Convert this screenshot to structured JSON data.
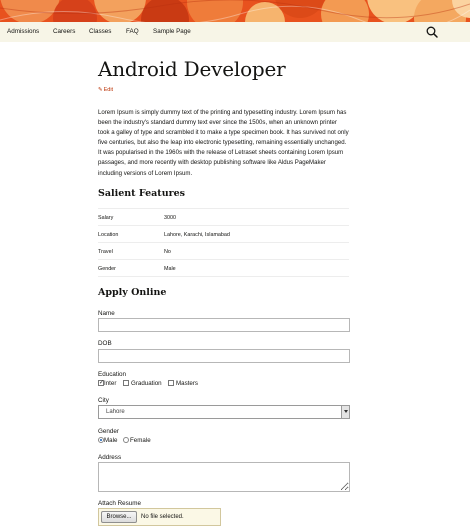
{
  "nav": {
    "items": [
      "Admissions",
      "Careers",
      "Classes",
      "FAQ",
      "Sample Page"
    ],
    "search_icon": "search-icon"
  },
  "colors": {
    "banner": "#e8521e",
    "nav_bg": "#f7f5e7",
    "link": "#bc360a"
  },
  "page": {
    "title": "Android Developer",
    "edit_label": "Edit",
    "description": "Lorem Ipsum is simply dummy text of the printing and typesetting industry. Lorem Ipsum has been the industry's standard dummy text ever since the 1500s, when an unknown printer took a galley of type and scrambled it to make a type specimen book. It has survived not only five centuries, but also the leap into electronic typesetting, remaining essentially unchanged. It was popularised in the 1960s with the release of Letraset sheets containing Lorem Ipsum passages, and more recently with desktop publishing software like Aldus PageMaker including versions of Lorem Ipsum."
  },
  "features": {
    "heading": "Salient Features",
    "rows": [
      {
        "label": "Salary",
        "value": "3000"
      },
      {
        "label": "Location",
        "value": "Lahore, Karachi, Islamabad"
      },
      {
        "label": "Travel",
        "value": "No"
      },
      {
        "label": "Gender",
        "value": "Male"
      }
    ]
  },
  "form": {
    "heading": "Apply Online",
    "name_label": "Name",
    "name_value": "",
    "dob_label": "DOB",
    "dob_value": "",
    "education_label": "Education",
    "education_options": [
      {
        "label": "Inter",
        "checked": true
      },
      {
        "label": "Graduation",
        "checked": false
      },
      {
        "label": "Masters",
        "checked": false
      }
    ],
    "city_label": "City",
    "city_value": "Lahore",
    "gender_label": "Gender",
    "gender_options": [
      {
        "label": "Male",
        "checked": true
      },
      {
        "label": "Female",
        "checked": false
      }
    ],
    "address_label": "Address",
    "address_value": "",
    "resume_label": "Attach Resume",
    "browse_label": "Browse...",
    "file_status": "No file selected."
  }
}
